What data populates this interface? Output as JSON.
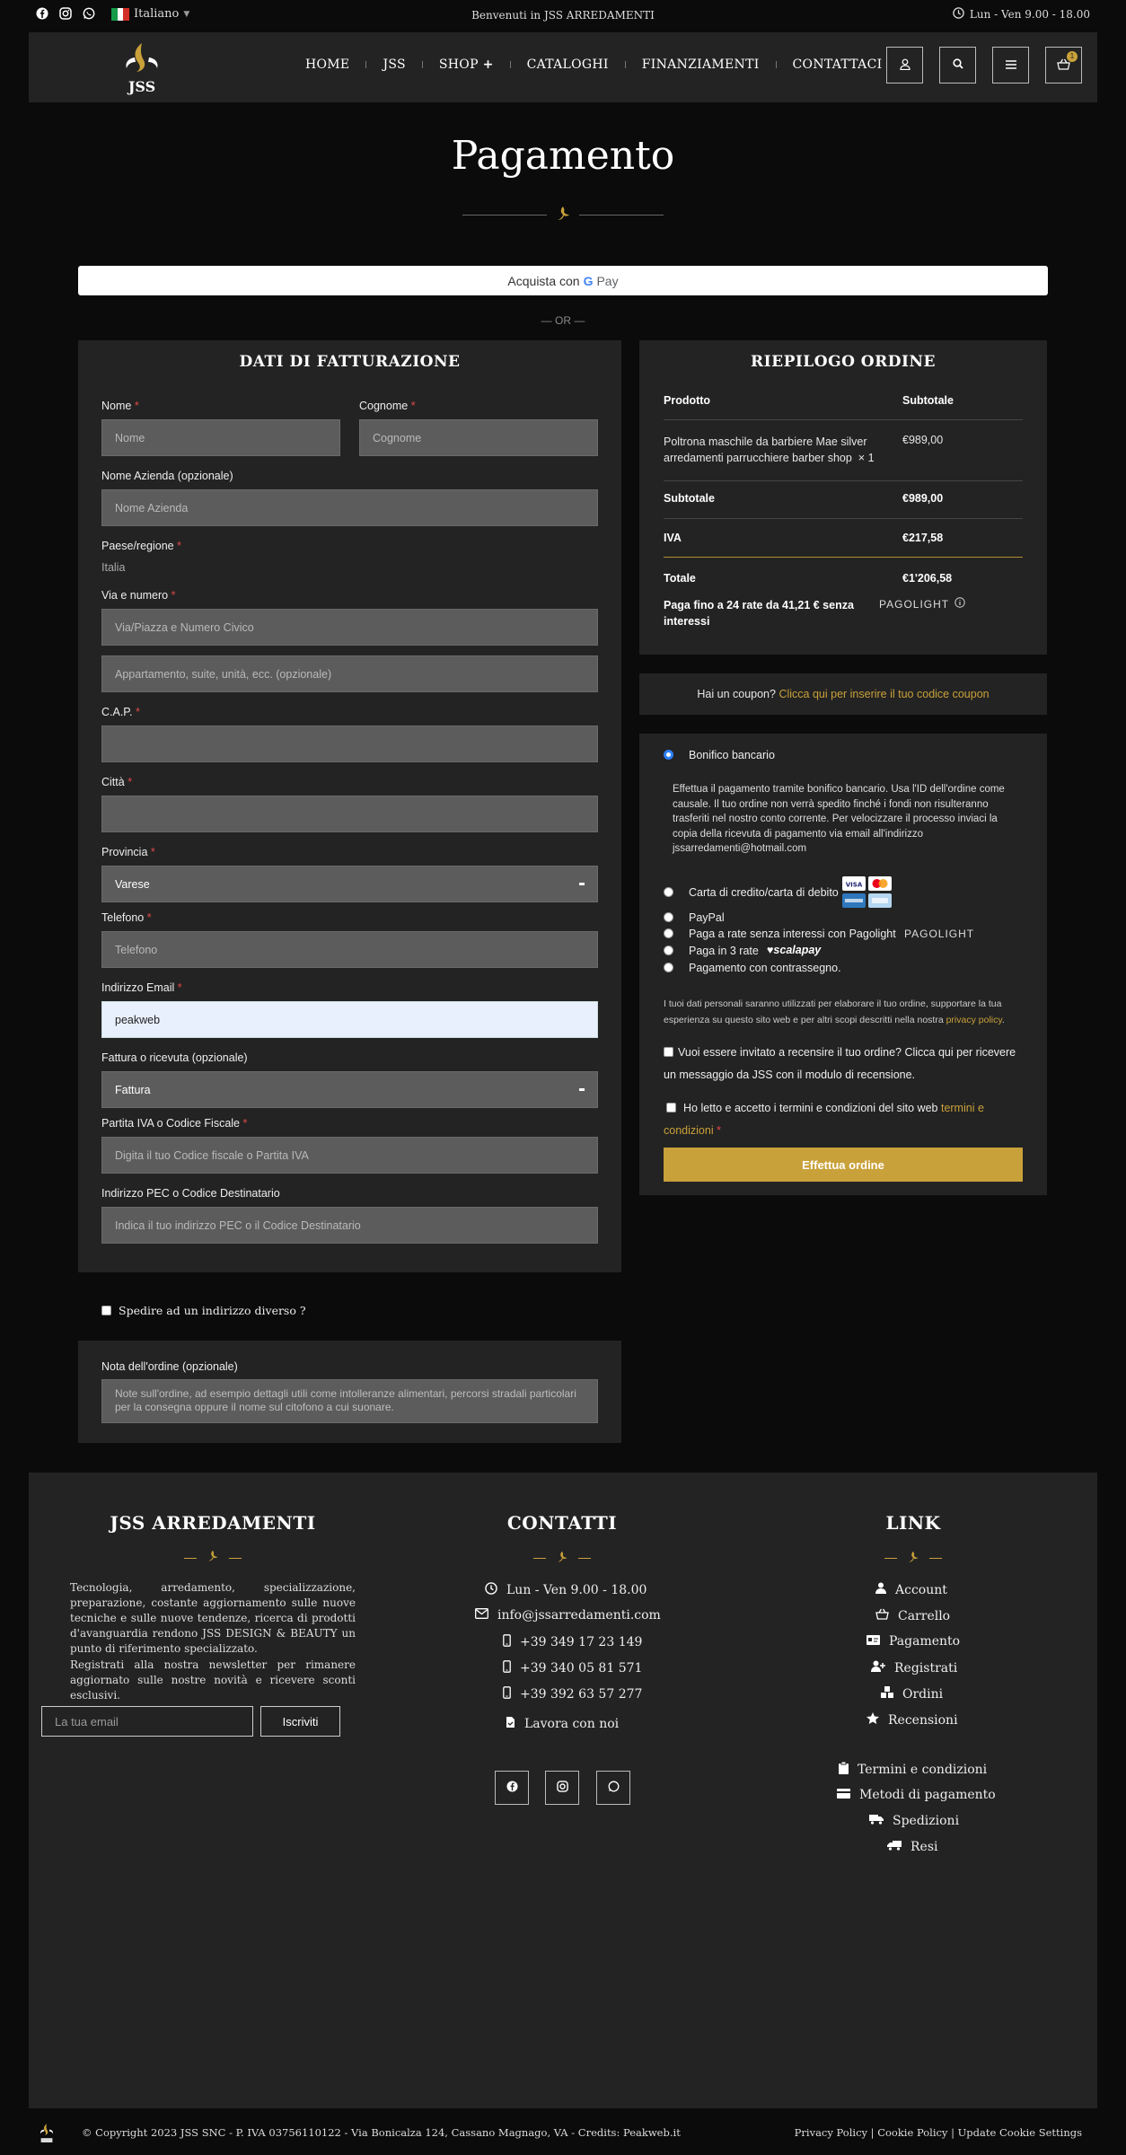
{
  "topbar": {
    "language": "Italiano",
    "welcome": "Benvenuti in JSS ARREDAMENTI",
    "hours": "Lun - Ven 9.00 - 18.00"
  },
  "header": {
    "logo_text": "JSS",
    "nav": [
      "HOME",
      "JSS",
      "SHOP",
      "CATALOGHI",
      "FINANZIAMENTI",
      "CONTATTACI"
    ],
    "cart_count": "1"
  },
  "page": {
    "title": "Pagamento",
    "gpay_label": "Acquista con",
    "gpay_brand_g": "G",
    "gpay_brand_pay": "Pay",
    "or": "— OR —"
  },
  "billing": {
    "title": "DATI DI FATTURAZIONE",
    "nome_label": "Nome",
    "nome_ph": "Nome",
    "cognome_label": "Cognome",
    "cognome_ph": "Cognome",
    "azienda_label": "Nome Azienda (opzionale)",
    "azienda_ph": "Nome Azienda",
    "paese_label": "Paese/regione",
    "paese_value": "Italia",
    "via_label": "Via e numero",
    "via_ph": "Via/Piazza e Numero Civico",
    "via2_ph": "Appartamento, suite, unità, ecc. (opzionale)",
    "cap_label": "C.A.P.",
    "citta_label": "Città",
    "provincia_label": "Provincia",
    "provincia_value": "Varese",
    "telefono_label": "Telefono",
    "telefono_ph": "Telefono",
    "email_label": "Indirizzo Email",
    "email_value": "peakweb",
    "fattura_label": "Fattura o ricevuta (opzionale)",
    "fattura_value": "Fattura",
    "piva_label": "Partita IVA o Codice Fiscale",
    "piva_ph": "Digita il tuo Codice fiscale o Partita IVA",
    "pec_label": "Indirizzo PEC o Codice Destinatario",
    "pec_ph": "Indica il tuo indirizzo PEC o il Codice Destinatario",
    "required_mark": "*"
  },
  "ship_diff": "Spedire ad un indirizzo diverso ?",
  "notes": {
    "label": "Nota dell'ordine (opzionale)",
    "placeholder": "Note sull'ordine, ad esempio dettagli utili come intolleranze alimentari, percorsi stradali particolari per la consegna oppure il nome sul citofono a cui suonare."
  },
  "summary": {
    "title": "RIEPILOGO ORDINE",
    "col_product": "Prodotto",
    "col_subtotal": "Subtotale",
    "product_name": "Poltrona maschile da barbiere Mae silver arredamenti parrucchiere barber shop",
    "product_qty": "× 1",
    "product_price": "€989,00",
    "subtotal_label": "Subtotale",
    "subtotal_value": "€989,00",
    "iva_label": "IVA",
    "iva_value": "€217,58",
    "total_label": "Totale",
    "total_value": "€1'206,58",
    "installments": "Paga fino a 24 rate da 41,21 € senza interessi",
    "pagolight_logo": "PAGOLIGHT"
  },
  "coupon": {
    "question": "Hai un coupon?",
    "link": "Clicca qui per inserire il tuo codice coupon"
  },
  "payment": {
    "bank_label": "Bonifico bancario",
    "bank_desc": "Effettua il pagamento tramite bonifico bancario. Usa l'ID dell'ordine come causale. Il tuo ordine non verrà spedito finché i fondi non risulteranno trasferiti nel nostro conto corrente. Per velocizzare il processo inviaci la copia della ricevuta di pagamento via email all'indirizzo jssarredamenti@hotmail.com",
    "card_label": "Carta di credito/carta di debito",
    "visa": "VISA",
    "paypal_label": "PayPal",
    "pagolight_label": "Paga a rate senza interessi con Pagolight",
    "pagolight_logo": "PAGOLIGHT",
    "scalapay_label": "Paga in 3 rate",
    "scalapay_logo": "♥scalapay",
    "cod_label": "Pagamento con contrassegno.",
    "privacy_text": "I tuoi dati personali saranno utilizzati per elaborare il tuo ordine, supportare la tua esperienza su questo sito web e per altri scopi descritti nella nostra",
    "privacy_link": "privacy policy",
    "review_text": "Vuoi essere invitato a recensire il tuo ordine? Clicca qui per ricevere un messaggio da JSS con il modulo di recensione.",
    "terms_text": "Ho letto e accetto i termini e condizioni del sito web",
    "terms_link": "termini e condizioni",
    "order_button": "Effettua ordine"
  },
  "footer": {
    "col1_title": "JSS ARREDAMENTI",
    "col1_p1": "Tecnologia, arredamento, specializzazione, preparazione, costante aggiornamento sulle nuove tecniche e sulle nuove tendenze, ricerca di prodotti d'avanguardia rendono JSS DESIGN & BEAUTY un punto di riferimento specializzato.",
    "col1_p2": "Registrati alla nostra newsletter per rimanere aggiornato sulle nostre novità e ricevere sconti esclusivi.",
    "newsletter_ph": "La tua email",
    "newsletter_btn": "Iscriviti",
    "col2_title": "CONTATTI",
    "contacts": [
      "Lun - Ven 9.00 - 18.00",
      "info@jssarredamenti.com",
      "+39 349 17 23 149",
      "+39 340 05 81 571",
      "+39 392 63 57 277",
      "Lavora con noi"
    ],
    "col3_title": "LINK",
    "links": [
      "Account",
      "Carrello",
      "Pagamento",
      "Registrati",
      "Ordini",
      "Recensioni"
    ],
    "links2": [
      "Termini e condizioni",
      "Metodi di pagamento",
      "Spedizioni",
      "Resi"
    ]
  },
  "bottom": {
    "copyright": "© Copyright 2023 JSS SNC - P. IVA 03756110122 - Via Bonicalza 124, Cassano Magnago, VA - Credits: Peakweb.it",
    "policies": "Privacy Policy | Cookie Policy | Update Cookie Settings"
  },
  "colors": {
    "accent": "#c9a13a",
    "panel": "#232323",
    "background": "#0b0b0b",
    "input": "#5c5c5c"
  }
}
